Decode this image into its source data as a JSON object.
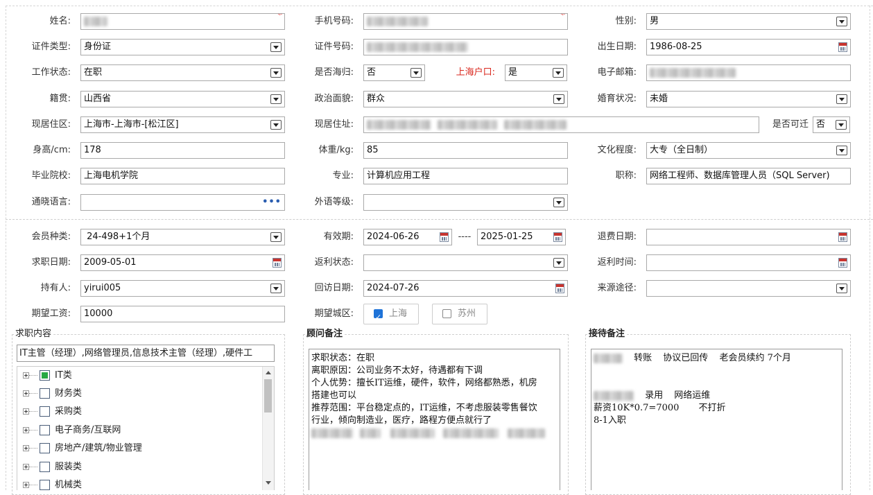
{
  "fields": {
    "name": {
      "label": "姓名:"
    },
    "mobile": {
      "label": "手机号码:"
    },
    "gender": {
      "label": "性别:",
      "value": "男"
    },
    "id_type": {
      "label": "证件类型:",
      "value": "身份证"
    },
    "id_number": {
      "label": "证件号码:"
    },
    "birth_date": {
      "label": "出生日期:",
      "value": "1986-08-25"
    },
    "work_status": {
      "label": "工作状态:",
      "value": "在职"
    },
    "overseas_returnee": {
      "label": "是否海归:",
      "value": "否"
    },
    "shanghai_hukou": {
      "label": "上海户口:",
      "value": "是"
    },
    "email": {
      "label": "电子邮箱:"
    },
    "native_place": {
      "label": "籍贯:",
      "value": "山西省"
    },
    "political_status": {
      "label": "政治面貌:",
      "value": "群众"
    },
    "marital_status": {
      "label": "婚育状况:",
      "value": "未婚"
    },
    "residence_area": {
      "label": "现居住区:",
      "value": "上海市-上海市-[松江区]"
    },
    "residence_address": {
      "label": "现居住址:"
    },
    "can_relocate": {
      "label": "是否可迁",
      "value": "否"
    },
    "height": {
      "label": "身高/cm:",
      "value": "178"
    },
    "weight": {
      "label": "体重/kg:",
      "value": "85"
    },
    "education": {
      "label": "文化程度:",
      "value": "大专（全日制）"
    },
    "school": {
      "label": "毕业院校:",
      "value": "上海电机学院"
    },
    "major": {
      "label": "专业:",
      "value": "计算机应用工程"
    },
    "title": {
      "label": "职称:",
      "value": "网络工程师、数据库管理人员（SQL Server)"
    },
    "languages": {
      "label": "通晓语言:",
      "value": "",
      "more": "•••"
    },
    "foreign_level": {
      "label": "外语等级:",
      "value": ""
    },
    "membership_type": {
      "label": "会员种类:",
      "value": " 24-498+1个月"
    },
    "valid_period": {
      "label": "有效期:",
      "start": "2024-06-26",
      "separator": "----",
      "end": "2025-01-25"
    },
    "refund_date": {
      "label": "退费日期:",
      "value": ""
    },
    "job_search_date": {
      "label": "求职日期:",
      "value": "2009-05-01"
    },
    "rebate_status": {
      "label": "返利状态:",
      "value": ""
    },
    "rebate_time": {
      "label": "返利时间:",
      "value": ""
    },
    "holder": {
      "label": "持有人:",
      "value": "yirui005"
    },
    "revisit_date": {
      "label": "回访日期:",
      "value": "2024-07-26"
    },
    "source": {
      "label": "来源途径:",
      "value": ""
    },
    "expected_salary": {
      "label": "期望工资:",
      "value": "10000"
    },
    "expected_city": {
      "label": "期望城区:",
      "options": [
        {
          "label": "上海",
          "checked": true
        },
        {
          "label": "苏州",
          "checked": false
        }
      ]
    }
  },
  "job_content": {
    "title": "求职内容",
    "summary": "IT主管（经理）,网络管理员,信息技术主管（经理）,硬件工",
    "categories": [
      {
        "label": "IT类",
        "state": "partial"
      },
      {
        "label": "财务类",
        "state": "unchecked"
      },
      {
        "label": "采购类",
        "state": "unchecked"
      },
      {
        "label": "电子商务/互联网",
        "state": "unchecked"
      },
      {
        "label": "房地产/建筑/物业管理",
        "state": "unchecked"
      },
      {
        "label": "服装类",
        "state": "unchecked"
      },
      {
        "label": "机械类",
        "state": "unchecked"
      }
    ]
  },
  "advisor_notes": {
    "title": "顾问备注",
    "lines": [
      "求职状态：在职",
      "离职原因：公司业务不太好，待遇都有下调",
      "个人优势：擅长IT运维，硬件，软件，网络都熟悉，机房",
      "搭建也可以",
      "推荐范围：平台稳定点的，IT运维，不考虑服装零售餐饮",
      "行业，倾向制造业，医疗，路程方便点就行了"
    ]
  },
  "reception_notes": {
    "title": "接待备注",
    "line1": {
      "a": "转账",
      "b": "协议已回传",
      "c": "老会员续约 7个月"
    },
    "line2": {
      "a": "录用",
      "b": "网络运维"
    },
    "line3": {
      "a": "薪资10K*0.7=7000",
      "b": "不打折"
    },
    "line4": "8-1入职"
  },
  "colors": {
    "required": "#e0201c",
    "hukou_label": "#d9261c",
    "checkbox_checked": "#1e73d8",
    "tree_partial": "#27a844"
  }
}
